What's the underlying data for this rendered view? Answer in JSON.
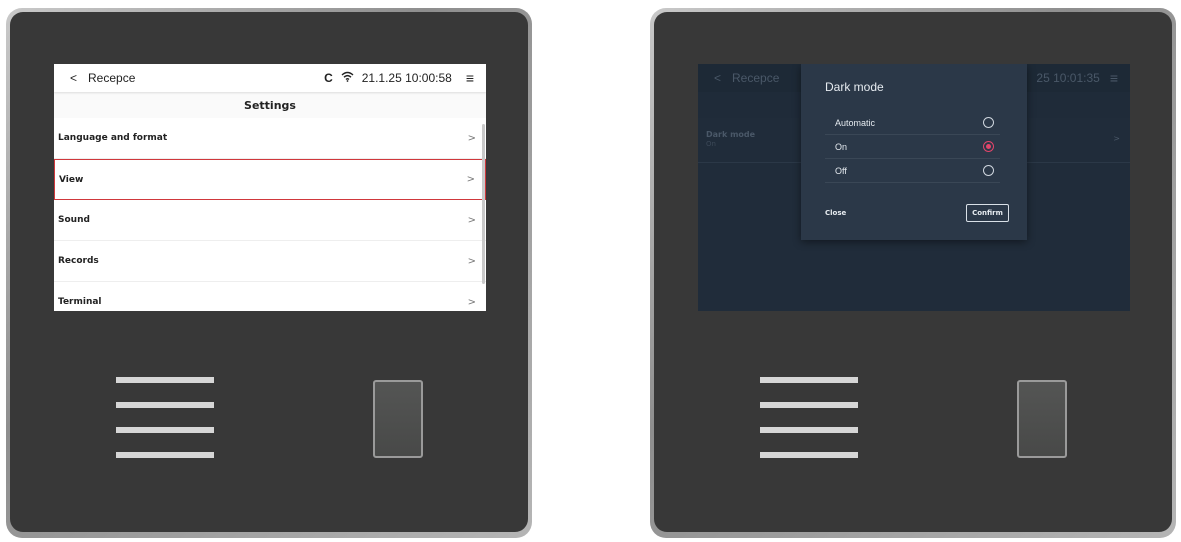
{
  "left_screen": {
    "header": {
      "back_symbol": "<",
      "title": "Recepce",
      "refresh_symbol": "C",
      "datetime": "21.1.25 10:00:58",
      "menu_symbol": "≡"
    },
    "subheader": "Settings",
    "items": [
      {
        "label": "Language and format",
        "chevron": ">"
      },
      {
        "label": "View",
        "chevron": ">"
      },
      {
        "label": "Sound",
        "chevron": ">"
      },
      {
        "label": "Records",
        "chevron": ">"
      },
      {
        "label": "Terminal",
        "chevron": ">"
      }
    ]
  },
  "right_screen": {
    "header": {
      "back_symbol": "<",
      "title": "Recepce",
      "datetime": "25 10:01:35",
      "menu_symbol": "≡"
    },
    "row": {
      "label": "Dark mode",
      "value": "On",
      "chevron": ">"
    },
    "dialog": {
      "title": "Dark mode",
      "options": [
        {
          "label": "Automatic",
          "selected": false
        },
        {
          "label": "On",
          "selected": true
        },
        {
          "label": "Off",
          "selected": false
        }
      ],
      "close_label": "Close",
      "confirm_label": "Confirm"
    }
  },
  "colors": {
    "selection_outline": "#d0383c",
    "radio_accent": "#e2456a",
    "device_body": "#383838",
    "dark_screen_bg": "#202c3a"
  }
}
